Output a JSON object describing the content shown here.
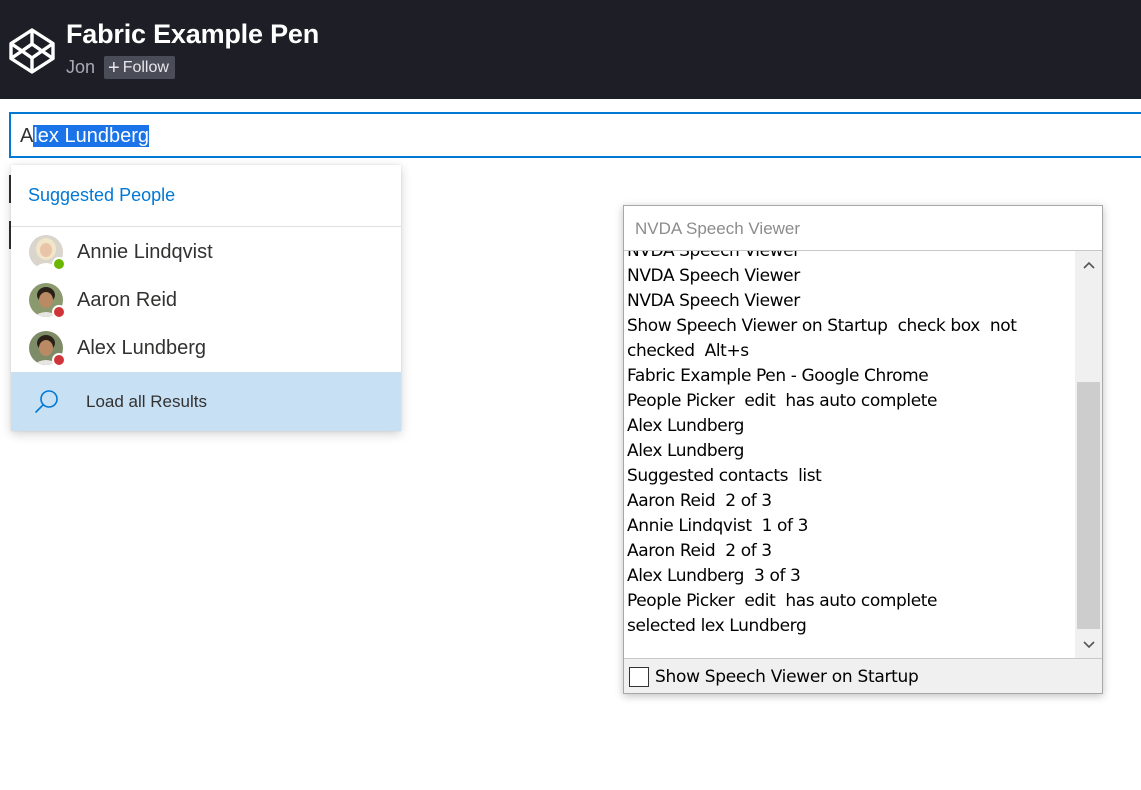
{
  "header": {
    "title": "Fabric Example Pen",
    "author": "Jon",
    "follow_label": "Follow",
    "background": "#1e1f26"
  },
  "picker": {
    "value_prefix": "A",
    "value_selected": "lex Lundberg",
    "accent": "#0078d4"
  },
  "suggestions": {
    "header": "Suggested People",
    "people": [
      {
        "name": "Annie Lindqvist",
        "presence": "online",
        "presence_color": "#6bb700"
      },
      {
        "name": "Aaron Reid",
        "presence": "busy",
        "presence_color": "#d13438"
      },
      {
        "name": "Alex Lundberg",
        "presence": "busy",
        "presence_color": "#d13438"
      }
    ],
    "load_all_label": "Load all Results",
    "load_all_icon": "search-icon"
  },
  "speech_viewer": {
    "title": "NVDA Speech Viewer",
    "lines": [
      "NVDA Speech Viewer",
      "NVDA Speech Viewer",
      "NVDA Speech Viewer",
      "Show Speech Viewer on Startup  check box  not",
      "checked  Alt+s",
      "Fabric Example Pen - Google Chrome",
      "People Picker  edit  has auto complete",
      "Alex Lundberg",
      "Alex Lundberg",
      "Suggested contacts  list",
      "Aaron Reid  2 of 3",
      "Annie Lindqvist  1 of 3",
      "Aaron Reid  2 of 3",
      "Alex Lundberg  3 of 3",
      "People Picker  edit  has auto complete",
      "selected lex Lundberg"
    ],
    "startup_checkbox_label": "Show Speech Viewer on Startup",
    "startup_checked": false
  }
}
